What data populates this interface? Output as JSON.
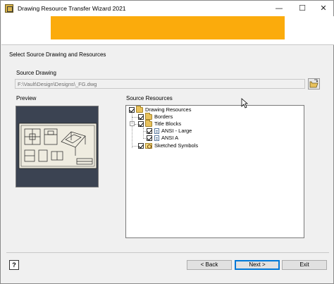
{
  "window": {
    "title": "Drawing Resource Transfer Wizard 2021",
    "controls": {
      "minimize": "—",
      "maximize": "☐",
      "close": "✕"
    }
  },
  "banner": {
    "color": "#fbab0c"
  },
  "section_title": "Select Source Drawing and Resources",
  "source_drawing": {
    "label": "Source Drawing",
    "path": "F:\\Vault\\Design\\Designs\\_FG.dwg",
    "browse_icon": "open-folder-icon"
  },
  "preview": {
    "label": "Preview"
  },
  "source_resources": {
    "label": "Source Resources",
    "tree": [
      {
        "label": "Drawing Resources",
        "checked": true,
        "icon": "folder-icon",
        "level": 0
      },
      {
        "label": "Borders",
        "checked": true,
        "icon": "folder-icon",
        "level": 1
      },
      {
        "label": "Title Blocks",
        "checked": true,
        "icon": "folder-icon",
        "level": 1,
        "expanded": true
      },
      {
        "label": "ANSI - Large",
        "checked": true,
        "icon": "sheet-icon",
        "level": 2
      },
      {
        "label": "ANSI A",
        "checked": true,
        "icon": "sheet-icon",
        "level": 2
      },
      {
        "label": "Sketched Symbols",
        "checked": true,
        "icon": "symbol-folder-icon",
        "level": 1
      }
    ]
  },
  "footer": {
    "help_label": "?",
    "back_label": "< Back",
    "next_label": "Next >",
    "exit_label": "Exit"
  }
}
